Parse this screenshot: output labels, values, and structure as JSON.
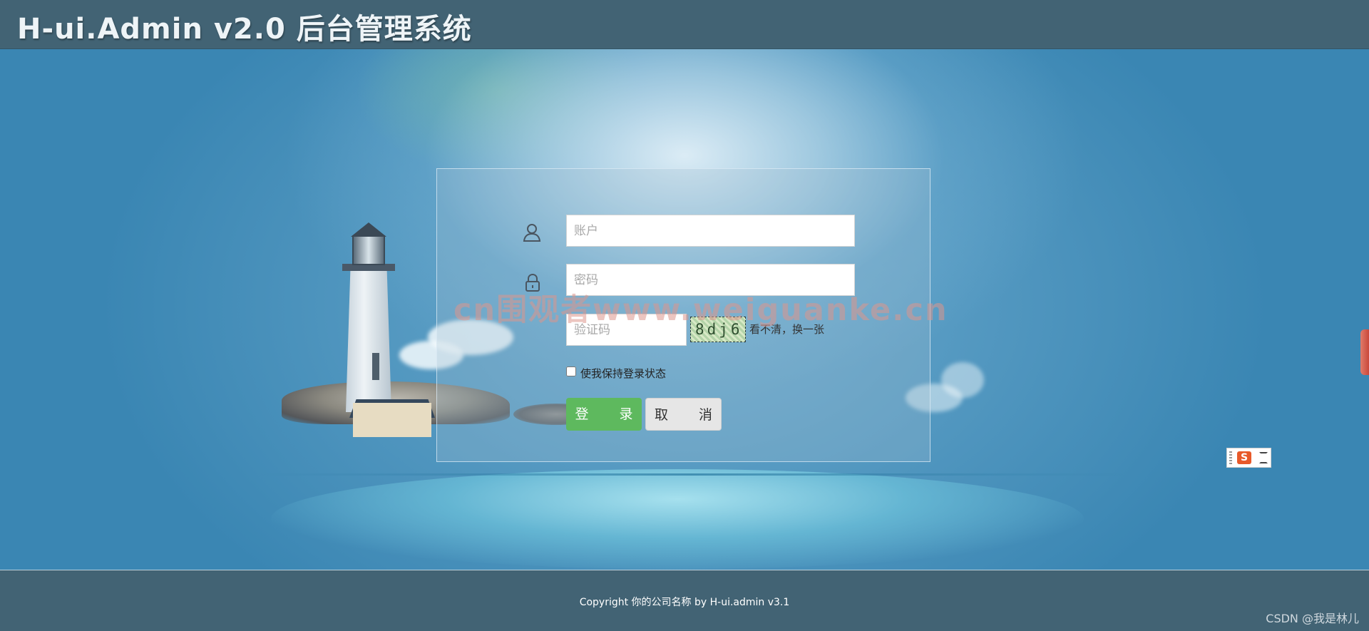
{
  "header": {
    "title": "H-ui.Admin v2.0 后台管理系统"
  },
  "login": {
    "account": {
      "value": "",
      "placeholder": "账户",
      "icon": "user-icon"
    },
    "password": {
      "value": "",
      "placeholder": "密码",
      "icon": "lock-icon"
    },
    "captcha": {
      "value": "",
      "placeholder": "验证码",
      "image_text": "8dj6",
      "refresh_label": "看不清，换一张"
    },
    "remember": {
      "label": "使我保持登录状态",
      "checked": false
    },
    "login_button": "登　录",
    "cancel_button": "取　消"
  },
  "watermark": "cn围观者www.weiguanke.cn",
  "ime_toolbar": {
    "logo": "S",
    "icons": [
      "grip-icon",
      "sogou-logo-icon",
      "expand-icon"
    ]
  },
  "footer": {
    "copyright": "Copyright 你的公司名称 by H-ui.admin v3.1",
    "credit": "CSDN @我是林儿"
  },
  "colors": {
    "header_bg": "#426374",
    "page_bg": "#3a86b3",
    "login_button_bg": "#5eb95e",
    "cancel_button_bg": "#e6e6e6"
  }
}
